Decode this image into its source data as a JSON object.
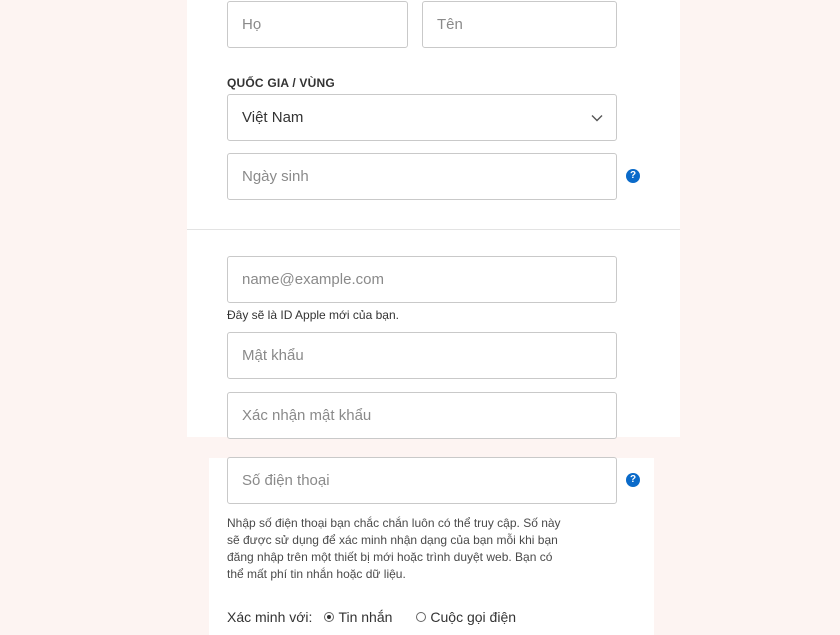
{
  "name_section": {
    "last_name_placeholder": "Họ",
    "first_name_placeholder": "Tên"
  },
  "country": {
    "label": "QUỐC GIA / VÙNG",
    "selected": "Việt Nam"
  },
  "birthday": {
    "placeholder": "Ngày sinh",
    "help": "?"
  },
  "account": {
    "email_placeholder": "name@example.com",
    "email_hint": "Đây sẽ là ID Apple mới của bạn.",
    "password_placeholder": "Mật khẩu",
    "confirm_password_placeholder": "Xác nhận mật khẩu"
  },
  "phone": {
    "placeholder": "Số điện thoại",
    "help": "?",
    "hint_lines": [
      "Nhập số điện thoại bạn chắc chắn luôn có thể truy cập. Số này",
      "sẽ được sử dụng để xác minh nhận dạng của bạn mỗi khi bạn",
      "đăng nhập trên một thiết bị mới hoặc trình duyệt web. Bạn có",
      "thể mất phí tin nhắn hoặc dữ liệu."
    ]
  },
  "verification": {
    "label": "Xác minh với:",
    "options": [
      {
        "label": "Tin nhắn",
        "selected": true
      },
      {
        "label": "Cuộc gọi điện",
        "selected": false
      }
    ]
  },
  "colors": {
    "background": "#fdf4f2",
    "panel": "#ffffff",
    "accent": "#0a6ac9",
    "border": "#c9c9c9"
  }
}
